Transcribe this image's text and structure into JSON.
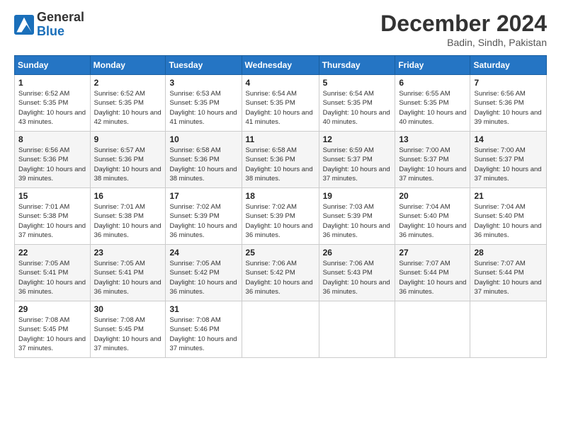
{
  "logo": {
    "general": "General",
    "blue": "Blue"
  },
  "header": {
    "title": "December 2024",
    "location": "Badin, Sindh, Pakistan"
  },
  "weekdays": [
    "Sunday",
    "Monday",
    "Tuesday",
    "Wednesday",
    "Thursday",
    "Friday",
    "Saturday"
  ],
  "weeks": [
    [
      {
        "day": "1",
        "sunrise": "6:52 AM",
        "sunset": "5:35 PM",
        "daylight": "10 hours and 43 minutes."
      },
      {
        "day": "2",
        "sunrise": "6:52 AM",
        "sunset": "5:35 PM",
        "daylight": "10 hours and 42 minutes."
      },
      {
        "day": "3",
        "sunrise": "6:53 AM",
        "sunset": "5:35 PM",
        "daylight": "10 hours and 41 minutes."
      },
      {
        "day": "4",
        "sunrise": "6:54 AM",
        "sunset": "5:35 PM",
        "daylight": "10 hours and 41 minutes."
      },
      {
        "day": "5",
        "sunrise": "6:54 AM",
        "sunset": "5:35 PM",
        "daylight": "10 hours and 40 minutes."
      },
      {
        "day": "6",
        "sunrise": "6:55 AM",
        "sunset": "5:35 PM",
        "daylight": "10 hours and 40 minutes."
      },
      {
        "day": "7",
        "sunrise": "6:56 AM",
        "sunset": "5:36 PM",
        "daylight": "10 hours and 39 minutes."
      }
    ],
    [
      {
        "day": "8",
        "sunrise": "6:56 AM",
        "sunset": "5:36 PM",
        "daylight": "10 hours and 39 minutes."
      },
      {
        "day": "9",
        "sunrise": "6:57 AM",
        "sunset": "5:36 PM",
        "daylight": "10 hours and 38 minutes."
      },
      {
        "day": "10",
        "sunrise": "6:58 AM",
        "sunset": "5:36 PM",
        "daylight": "10 hours and 38 minutes."
      },
      {
        "day": "11",
        "sunrise": "6:58 AM",
        "sunset": "5:36 PM",
        "daylight": "10 hours and 38 minutes."
      },
      {
        "day": "12",
        "sunrise": "6:59 AM",
        "sunset": "5:37 PM",
        "daylight": "10 hours and 37 minutes."
      },
      {
        "day": "13",
        "sunrise": "7:00 AM",
        "sunset": "5:37 PM",
        "daylight": "10 hours and 37 minutes."
      },
      {
        "day": "14",
        "sunrise": "7:00 AM",
        "sunset": "5:37 PM",
        "daylight": "10 hours and 37 minutes."
      }
    ],
    [
      {
        "day": "15",
        "sunrise": "7:01 AM",
        "sunset": "5:38 PM",
        "daylight": "10 hours and 37 minutes."
      },
      {
        "day": "16",
        "sunrise": "7:01 AM",
        "sunset": "5:38 PM",
        "daylight": "10 hours and 36 minutes."
      },
      {
        "day": "17",
        "sunrise": "7:02 AM",
        "sunset": "5:39 PM",
        "daylight": "10 hours and 36 minutes."
      },
      {
        "day": "18",
        "sunrise": "7:02 AM",
        "sunset": "5:39 PM",
        "daylight": "10 hours and 36 minutes."
      },
      {
        "day": "19",
        "sunrise": "7:03 AM",
        "sunset": "5:39 PM",
        "daylight": "10 hours and 36 minutes."
      },
      {
        "day": "20",
        "sunrise": "7:04 AM",
        "sunset": "5:40 PM",
        "daylight": "10 hours and 36 minutes."
      },
      {
        "day": "21",
        "sunrise": "7:04 AM",
        "sunset": "5:40 PM",
        "daylight": "10 hours and 36 minutes."
      }
    ],
    [
      {
        "day": "22",
        "sunrise": "7:05 AM",
        "sunset": "5:41 PM",
        "daylight": "10 hours and 36 minutes."
      },
      {
        "day": "23",
        "sunrise": "7:05 AM",
        "sunset": "5:41 PM",
        "daylight": "10 hours and 36 minutes."
      },
      {
        "day": "24",
        "sunrise": "7:05 AM",
        "sunset": "5:42 PM",
        "daylight": "10 hours and 36 minutes."
      },
      {
        "day": "25",
        "sunrise": "7:06 AM",
        "sunset": "5:42 PM",
        "daylight": "10 hours and 36 minutes."
      },
      {
        "day": "26",
        "sunrise": "7:06 AM",
        "sunset": "5:43 PM",
        "daylight": "10 hours and 36 minutes."
      },
      {
        "day": "27",
        "sunrise": "7:07 AM",
        "sunset": "5:44 PM",
        "daylight": "10 hours and 36 minutes."
      },
      {
        "day": "28",
        "sunrise": "7:07 AM",
        "sunset": "5:44 PM",
        "daylight": "10 hours and 37 minutes."
      }
    ],
    [
      {
        "day": "29",
        "sunrise": "7:08 AM",
        "sunset": "5:45 PM",
        "daylight": "10 hours and 37 minutes."
      },
      {
        "day": "30",
        "sunrise": "7:08 AM",
        "sunset": "5:45 PM",
        "daylight": "10 hours and 37 minutes."
      },
      {
        "day": "31",
        "sunrise": "7:08 AM",
        "sunset": "5:46 PM",
        "daylight": "10 hours and 37 minutes."
      },
      null,
      null,
      null,
      null
    ]
  ]
}
